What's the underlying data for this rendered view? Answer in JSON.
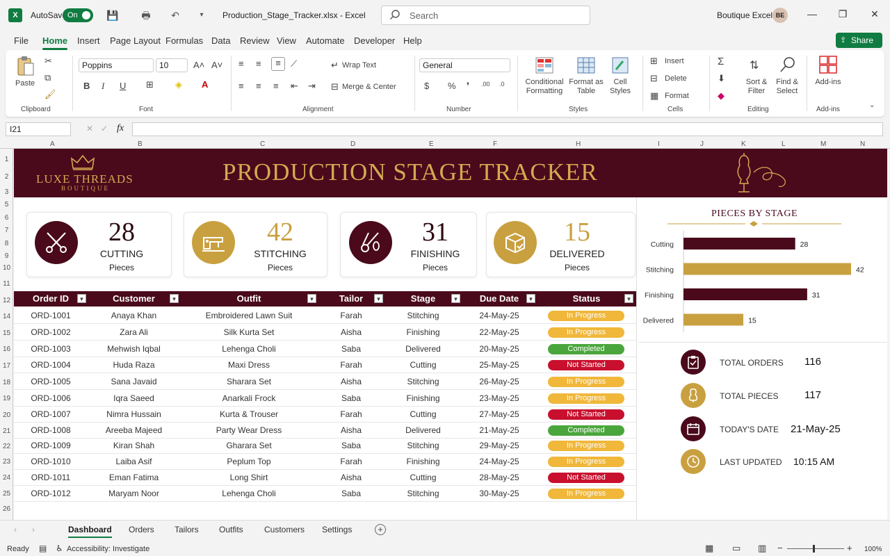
{
  "titlebar": {
    "autosave_label": "AutoSave",
    "autosave_state": "On",
    "file_title": "Production_Stage_Tracker.xlsx  -  Excel",
    "search_placeholder": "Search",
    "user_name": "Boutique Excel",
    "user_initials": "BE"
  },
  "menu": {
    "items": [
      "File",
      "Home",
      "Insert",
      "Page Layout",
      "Formulas",
      "Data",
      "Review",
      "View",
      "Automate",
      "Developer",
      "Help"
    ],
    "active": "Home",
    "share_label": "Share"
  },
  "ribbon": {
    "paste_label": "Paste",
    "font_name": "Poppins",
    "font_size": "10",
    "wrap_text": "Wrap Text",
    "merge_center": "Merge & Center",
    "number_format": "General",
    "conditional_formatting": "Conditional Formatting",
    "format_as_table": "Format as Table",
    "cell_styles": "Cell Styles",
    "insert": "Insert",
    "delete": "Delete",
    "format": "Format",
    "sort_filter": "Sort & Filter",
    "find_select": "Find & Select",
    "addins": "Add-ins",
    "groups": [
      "Clipboard",
      "Font",
      "Alignment",
      "Number",
      "Styles",
      "Cells",
      "Editing",
      "Add-ins"
    ]
  },
  "formula_bar": {
    "name_box": "I21",
    "fx": "fx",
    "content": ""
  },
  "columns": [
    "A",
    "B",
    "C",
    "D",
    "E",
    "F",
    "H",
    "I",
    "J",
    "K",
    "L",
    "M",
    "N"
  ],
  "rows": [
    "1",
    "2",
    "3",
    "5",
    "6",
    "7",
    "8",
    "9",
    "10",
    "11",
    "12",
    "14",
    "15",
    "16",
    "17",
    "18",
    "19",
    "20",
    "21",
    "22",
    "23",
    "24",
    "25",
    "26"
  ],
  "banner": {
    "brand_name": "LUXE THREADS",
    "brand_sub": "BOUTIQUE",
    "title": "PRODUCTION STAGE TRACKER"
  },
  "kpis": [
    {
      "value": "28",
      "label": "CUTTING",
      "sub": "Pieces"
    },
    {
      "value": "42",
      "label": "STITCHING",
      "sub": "Pieces"
    },
    {
      "value": "31",
      "label": "FINISHING",
      "sub": "Pieces"
    },
    {
      "value": "15",
      "label": "DELIVERED",
      "sub": "Pieces"
    }
  ],
  "table": {
    "headers": [
      "Order ID",
      "Customer",
      "Outfit",
      "Tailor",
      "Stage",
      "Due Date",
      "Status"
    ],
    "rows": [
      [
        "ORD-1001",
        "Anaya Khan",
        "Embroidered Lawn Suit",
        "Farah",
        "Stitching",
        "24-May-25",
        "In Progress"
      ],
      [
        "ORD-1002",
        "Zara Ali",
        "Silk Kurta Set",
        "Aisha",
        "Finishing",
        "22-May-25",
        "In Progress"
      ],
      [
        "ORD-1003",
        "Mehwish Iqbal",
        "Lehenga Choli",
        "Saba",
        "Delivered",
        "20-May-25",
        "Completed"
      ],
      [
        "ORD-1004",
        "Huda Raza",
        "Maxi Dress",
        "Farah",
        "Cutting",
        "25-May-25",
        "Not Started"
      ],
      [
        "ORD-1005",
        "Sana Javaid",
        "Sharara Set",
        "Aisha",
        "Stitching",
        "26-May-25",
        "In Progress"
      ],
      [
        "ORD-1006",
        "Iqra Saeed",
        "Anarkali Frock",
        "Saba",
        "Finishing",
        "23-May-25",
        "In Progress"
      ],
      [
        "ORD-1007",
        "Nimra Hussain",
        "Kurta & Trouser",
        "Farah",
        "Cutting",
        "27-May-25",
        "Not Started"
      ],
      [
        "ORD-1008",
        "Areeba Majeed",
        "Party Wear Dress",
        "Aisha",
        "Delivered",
        "21-May-25",
        "Completed"
      ],
      [
        "ORD-1009",
        "Kiran Shah",
        "Gharara Set",
        "Saba",
        "Stitching",
        "29-May-25",
        "In Progress"
      ],
      [
        "ORD-1010",
        "Laiba Asif",
        "Peplum Top",
        "Farah",
        "Finishing",
        "24-May-25",
        "In Progress"
      ],
      [
        "ORD-1011",
        "Eman Fatima",
        "Long Shirt",
        "Aisha",
        "Cutting",
        "28-May-25",
        "Not Started"
      ],
      [
        "ORD-1012",
        "Maryam Noor",
        "Lehenga Choli",
        "Saba",
        "Stitching",
        "30-May-25",
        "In Progress"
      ]
    ]
  },
  "status_colors": {
    "In Progress": "#f0b73a",
    "Completed": "#4aa63c",
    "Not Started": "#c8102e"
  },
  "colors": {
    "maroon": "#4a0a1c",
    "gold": "#c9a040",
    "excel_green": "#107c41"
  },
  "chart_data": {
    "type": "bar",
    "orientation": "horizontal",
    "title": "PIECES BY STAGE",
    "categories": [
      "Cutting",
      "Stitching",
      "Finishing",
      "Delivered"
    ],
    "values": [
      28,
      42,
      31,
      15
    ],
    "bar_colors": [
      "#4a0a1c",
      "#c9a040",
      "#4a0a1c",
      "#c9a040"
    ],
    "xlim": [
      0,
      42
    ],
    "grid": false,
    "data_labels": true
  },
  "summary": [
    {
      "label": "TOTAL ORDERS",
      "value": "116",
      "icon": "clipboard-icon"
    },
    {
      "label": "TOTAL PIECES",
      "value": "117",
      "icon": "dress-form-icon"
    },
    {
      "label": "TODAY'S DATE",
      "value": "21-May-25",
      "icon": "calendar-icon"
    },
    {
      "label": "LAST UPDATED",
      "value": "10:15 AM",
      "icon": "clock-icon"
    }
  ],
  "sheet_tabs": [
    "Dashboard",
    "Orders",
    "Tailors",
    "Outfits",
    "Customers",
    "Settings"
  ],
  "active_tab": "Dashboard",
  "statusbar": {
    "ready": "Ready",
    "accessibility": "Accessibility: Investigate",
    "zoom": "100%"
  }
}
